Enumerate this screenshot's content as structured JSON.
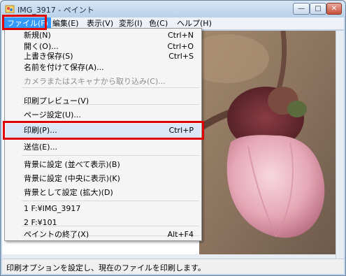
{
  "window": {
    "title": "IMG_3917 - ペイント",
    "minimize_glyph": "—",
    "maximize_glyph": "□",
    "close_glyph": "✕"
  },
  "menubar": {
    "items": [
      {
        "label": "ファイル(F)",
        "active": true
      },
      {
        "label": "編集(E)"
      },
      {
        "label": "表示(V)"
      },
      {
        "label": "変形(I)"
      },
      {
        "label": "色(C)"
      },
      {
        "label": "ヘルプ(H)"
      }
    ]
  },
  "file_menu": {
    "items": [
      {
        "label": "新規(N)",
        "shortcut": "Ctrl+N"
      },
      {
        "label": "開く(O)...",
        "shortcut": "Ctrl+O"
      },
      {
        "label": "上書き保存(S)",
        "shortcut": "Ctrl+S"
      },
      {
        "label": "名前を付けて保存(A)...",
        "shortcut": ""
      },
      {
        "label": "カメラまたはスキャナから取り込み(C)...",
        "shortcut": "",
        "disabled": true
      },
      {
        "label": "印刷プレビュー(V)",
        "shortcut": ""
      },
      {
        "label": "ページ設定(U)...",
        "shortcut": ""
      },
      {
        "label": "印刷(P)...",
        "shortcut": "Ctrl+P",
        "highlighted": true
      },
      {
        "label": "送信(E)...",
        "shortcut": ""
      },
      {
        "label": "背景に設定 (並べて表示)(B)",
        "shortcut": ""
      },
      {
        "label": "背景に設定 (中央に表示)(K)",
        "shortcut": ""
      },
      {
        "label": "背景として設定 (拡大)(D)",
        "shortcut": ""
      },
      {
        "label": "1 F:¥IMG_3917",
        "shortcut": ""
      },
      {
        "label": "2 F:¥101",
        "shortcut": ""
      },
      {
        "label": "ペイントの終了(X)",
        "shortcut": "Alt+F4"
      }
    ]
  },
  "statusbar": {
    "text": "印刷オプションを設定し、現在のファイルを印刷します。"
  },
  "colors": {
    "highlight_frame": "#e00000",
    "menu_active": "#3399ff"
  }
}
